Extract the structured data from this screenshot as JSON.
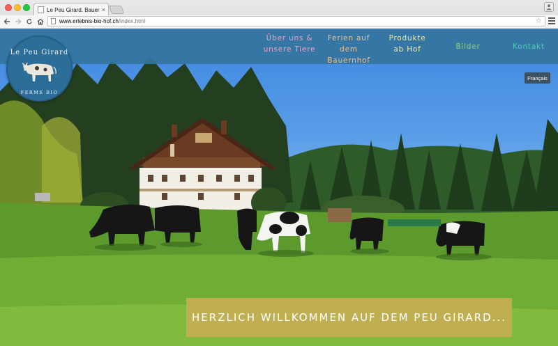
{
  "browser": {
    "tab_title": "Le Peu Girard. Bauernhof.",
    "tab_close": "×",
    "url_host": "www.erlebnis-bio-hof.ch",
    "url_path": "/index.html",
    "profile_glyph": "👤"
  },
  "nav": {
    "ueber": {
      "line1": "Über uns &",
      "line2": "unsere Tiere"
    },
    "ferien": {
      "line1": "Ferien auf dem",
      "line2": "Bauernhof"
    },
    "produkte": {
      "line1": "Produkte",
      "line2": "ab Hof"
    },
    "bilder": "Bilder",
    "kontakt": "Kontakt"
  },
  "logo": {
    "top": "Le Peu Girard",
    "bottom": "FERME BIO"
  },
  "language_button": "Français",
  "welcome": "Herzlich Willkommen auf dem Peu Girard...",
  "colors": {
    "navbar": "#34749e",
    "nav_ueber": "#e7a6c2",
    "nav_ferien": "#f0c38a",
    "nav_produkte": "#f3ec9c",
    "nav_bilder": "#8fd27f",
    "nav_kontakt": "#4fd1b8",
    "welcome_bg": "#c4ac54"
  }
}
